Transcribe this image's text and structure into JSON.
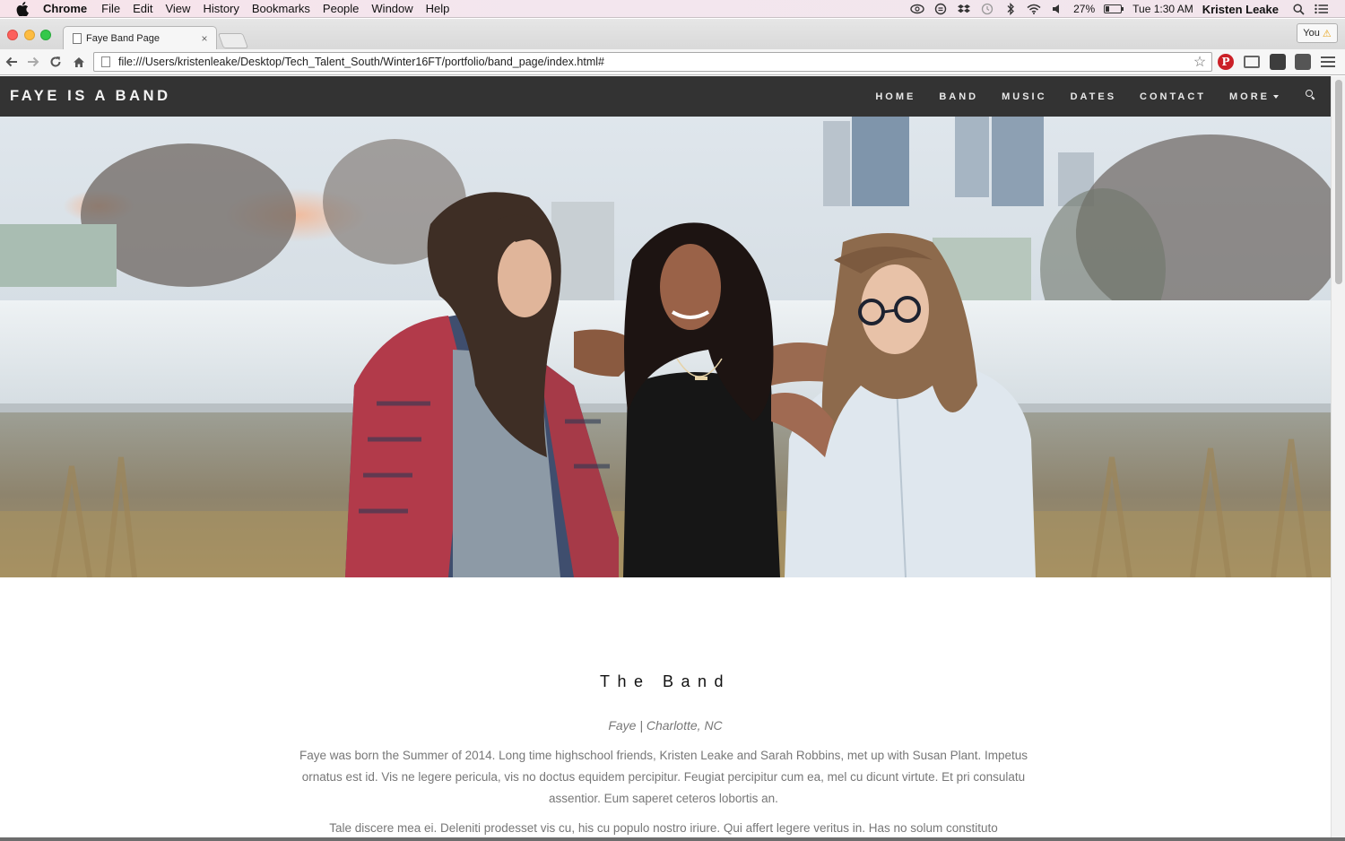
{
  "os_menubar": {
    "app": "Chrome",
    "menus": [
      "File",
      "Edit",
      "View",
      "History",
      "Bookmarks",
      "People",
      "Window",
      "Help"
    ],
    "battery_text": "27%",
    "battery_level_pct": 27,
    "time": "Tue 1:30 AM",
    "user": "Kristen Leake"
  },
  "browser": {
    "tab_title": "Faye Band Page",
    "tab_close": "×",
    "profile_label": "You",
    "profile_warning": "⚠",
    "url": "file:///Users/kristenleake/Desktop/Tech_Talent_South/Winter16FT/portfolio/band_page/index.html#",
    "pinterest_glyph": "P"
  },
  "site": {
    "brand": "FAYE IS A BAND",
    "nav": [
      "HOME",
      "BAND",
      "MUSIC",
      "DATES",
      "CONTACT",
      "MORE"
    ]
  },
  "band_section": {
    "title": "The Band",
    "subtitle": "Faye | Charlotte, NC",
    "paragraph1": "Faye was born the Summer of 2014. Long time highschool friends, Kristen Leake and Sarah Robbins, met up with Susan Plant. Impetus ornatus est id. Vis ne legere pericula, vis no doctus equidem percipitur. Feugiat percipitur cum ea, mel cu dicunt virtute. Et pri consulatu assentior. Eum saperet ceteros lobortis an.",
    "paragraph2": "Tale discere mea ei. Deleniti prodesset vis cu, his cu populo nostro iriure. Qui affert legere veritus in. Has no solum constituto comprehensa."
  },
  "colors": {
    "navbar": "#333333",
    "text_muted": "#777777",
    "pinterest": "#cb2027"
  }
}
